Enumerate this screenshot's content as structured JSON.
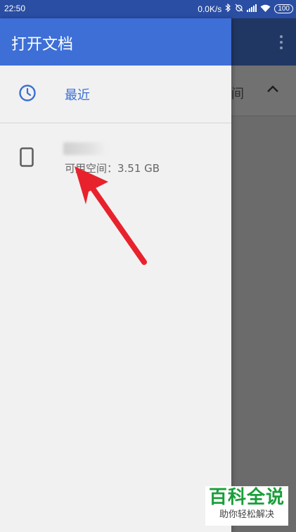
{
  "status_bar": {
    "time": "22:50",
    "network_speed": "0.0K/s",
    "battery": "100",
    "icons": [
      "bluetooth-icon",
      "alarm-off-icon",
      "signal-icon",
      "wifi-icon"
    ]
  },
  "drawer": {
    "title": "打开文档",
    "recent_label": "最近",
    "device": {
      "name": "",
      "storage": "可用空间：3.51 GB"
    }
  },
  "background": {
    "row_text": "间",
    "more_icon": "more-vert-icon"
  },
  "watermark": {
    "title": "百科全说",
    "subtitle": "助你轻松解决"
  },
  "colors": {
    "status_bar": "#2a4ea3",
    "drawer_header": "#3d6fd6",
    "accent": "#3b6fd2",
    "arrow": "#e8222d",
    "watermark_green": "#1a9e3a"
  }
}
